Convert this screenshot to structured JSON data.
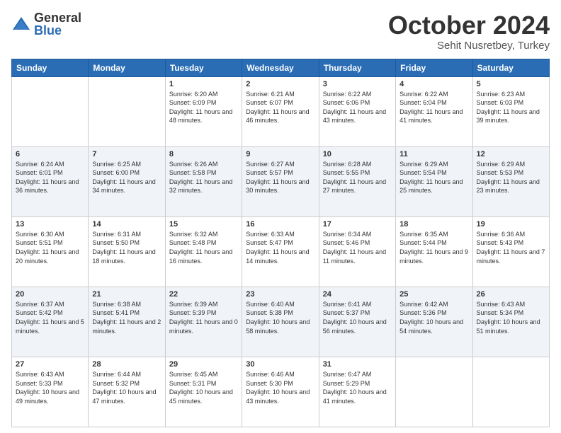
{
  "header": {
    "logo_general": "General",
    "logo_blue": "Blue",
    "month_title": "October 2024",
    "location": "Sehit Nusretbey, Turkey"
  },
  "days_of_week": [
    "Sunday",
    "Monday",
    "Tuesday",
    "Wednesday",
    "Thursday",
    "Friday",
    "Saturday"
  ],
  "weeks": [
    [
      {
        "day": "",
        "content": ""
      },
      {
        "day": "",
        "content": ""
      },
      {
        "day": "1",
        "content": "Sunrise: 6:20 AM\nSunset: 6:09 PM\nDaylight: 11 hours and 48 minutes."
      },
      {
        "day": "2",
        "content": "Sunrise: 6:21 AM\nSunset: 6:07 PM\nDaylight: 11 hours and 46 minutes."
      },
      {
        "day": "3",
        "content": "Sunrise: 6:22 AM\nSunset: 6:06 PM\nDaylight: 11 hours and 43 minutes."
      },
      {
        "day": "4",
        "content": "Sunrise: 6:22 AM\nSunset: 6:04 PM\nDaylight: 11 hours and 41 minutes."
      },
      {
        "day": "5",
        "content": "Sunrise: 6:23 AM\nSunset: 6:03 PM\nDaylight: 11 hours and 39 minutes."
      }
    ],
    [
      {
        "day": "6",
        "content": "Sunrise: 6:24 AM\nSunset: 6:01 PM\nDaylight: 11 hours and 36 minutes."
      },
      {
        "day": "7",
        "content": "Sunrise: 6:25 AM\nSunset: 6:00 PM\nDaylight: 11 hours and 34 minutes."
      },
      {
        "day": "8",
        "content": "Sunrise: 6:26 AM\nSunset: 5:58 PM\nDaylight: 11 hours and 32 minutes."
      },
      {
        "day": "9",
        "content": "Sunrise: 6:27 AM\nSunset: 5:57 PM\nDaylight: 11 hours and 30 minutes."
      },
      {
        "day": "10",
        "content": "Sunrise: 6:28 AM\nSunset: 5:55 PM\nDaylight: 11 hours and 27 minutes."
      },
      {
        "day": "11",
        "content": "Sunrise: 6:29 AM\nSunset: 5:54 PM\nDaylight: 11 hours and 25 minutes."
      },
      {
        "day": "12",
        "content": "Sunrise: 6:29 AM\nSunset: 5:53 PM\nDaylight: 11 hours and 23 minutes."
      }
    ],
    [
      {
        "day": "13",
        "content": "Sunrise: 6:30 AM\nSunset: 5:51 PM\nDaylight: 11 hours and 20 minutes."
      },
      {
        "day": "14",
        "content": "Sunrise: 6:31 AM\nSunset: 5:50 PM\nDaylight: 11 hours and 18 minutes."
      },
      {
        "day": "15",
        "content": "Sunrise: 6:32 AM\nSunset: 5:48 PM\nDaylight: 11 hours and 16 minutes."
      },
      {
        "day": "16",
        "content": "Sunrise: 6:33 AM\nSunset: 5:47 PM\nDaylight: 11 hours and 14 minutes."
      },
      {
        "day": "17",
        "content": "Sunrise: 6:34 AM\nSunset: 5:46 PM\nDaylight: 11 hours and 11 minutes."
      },
      {
        "day": "18",
        "content": "Sunrise: 6:35 AM\nSunset: 5:44 PM\nDaylight: 11 hours and 9 minutes."
      },
      {
        "day": "19",
        "content": "Sunrise: 6:36 AM\nSunset: 5:43 PM\nDaylight: 11 hours and 7 minutes."
      }
    ],
    [
      {
        "day": "20",
        "content": "Sunrise: 6:37 AM\nSunset: 5:42 PM\nDaylight: 11 hours and 5 minutes."
      },
      {
        "day": "21",
        "content": "Sunrise: 6:38 AM\nSunset: 5:41 PM\nDaylight: 11 hours and 2 minutes."
      },
      {
        "day": "22",
        "content": "Sunrise: 6:39 AM\nSunset: 5:39 PM\nDaylight: 11 hours and 0 minutes."
      },
      {
        "day": "23",
        "content": "Sunrise: 6:40 AM\nSunset: 5:38 PM\nDaylight: 10 hours and 58 minutes."
      },
      {
        "day": "24",
        "content": "Sunrise: 6:41 AM\nSunset: 5:37 PM\nDaylight: 10 hours and 56 minutes."
      },
      {
        "day": "25",
        "content": "Sunrise: 6:42 AM\nSunset: 5:36 PM\nDaylight: 10 hours and 54 minutes."
      },
      {
        "day": "26",
        "content": "Sunrise: 6:43 AM\nSunset: 5:34 PM\nDaylight: 10 hours and 51 minutes."
      }
    ],
    [
      {
        "day": "27",
        "content": "Sunrise: 6:43 AM\nSunset: 5:33 PM\nDaylight: 10 hours and 49 minutes."
      },
      {
        "day": "28",
        "content": "Sunrise: 6:44 AM\nSunset: 5:32 PM\nDaylight: 10 hours and 47 minutes."
      },
      {
        "day": "29",
        "content": "Sunrise: 6:45 AM\nSunset: 5:31 PM\nDaylight: 10 hours and 45 minutes."
      },
      {
        "day": "30",
        "content": "Sunrise: 6:46 AM\nSunset: 5:30 PM\nDaylight: 10 hours and 43 minutes."
      },
      {
        "day": "31",
        "content": "Sunrise: 6:47 AM\nSunset: 5:29 PM\nDaylight: 10 hours and 41 minutes."
      },
      {
        "day": "",
        "content": ""
      },
      {
        "day": "",
        "content": ""
      }
    ]
  ]
}
